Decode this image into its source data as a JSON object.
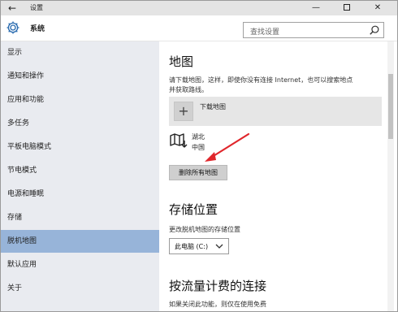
{
  "window": {
    "title": "设置"
  },
  "header": {
    "section_title": "系统",
    "search_placeholder": "查找设置"
  },
  "sidebar": {
    "items": [
      {
        "label": "显示",
        "active": false
      },
      {
        "label": "通知和操作",
        "active": false
      },
      {
        "label": "应用和功能",
        "active": false
      },
      {
        "label": "多任务",
        "active": false
      },
      {
        "label": "平板电脑模式",
        "active": false
      },
      {
        "label": "节电模式",
        "active": false
      },
      {
        "label": "电源和睡眠",
        "active": false
      },
      {
        "label": "存储",
        "active": false
      },
      {
        "label": "脱机地图",
        "active": true
      },
      {
        "label": "默认应用",
        "active": false
      },
      {
        "label": "关于",
        "active": false
      }
    ]
  },
  "main": {
    "maps_heading": "地图",
    "maps_desc_line1": "请下载地图，这样，即使你没有连接 Internet，也可以搜索地点",
    "maps_desc_line2": "并获取路线。",
    "download_label": "下载地图",
    "map_item": {
      "name": "湖北",
      "region": "中国"
    },
    "delete_all_label": "删除所有地图",
    "storage_heading": "存储位置",
    "storage_desc": "更改脱机地图的存储位置",
    "storage_value": "此电脑 (C:)",
    "metered_heading": "按流量计费的连接",
    "metered_desc": "如果关闭此功能，则仅在使用免费"
  },
  "colors": {
    "sidebar_bg": "#e9ebf0",
    "active_item": "#97b4d9",
    "annotation_arrow": "#e0262b"
  },
  "icons": {
    "back": "back-arrow-icon",
    "gear": "gear-icon",
    "search": "search-icon",
    "plus": "plus-icon",
    "map": "map-download-icon",
    "chevron": "chevron-down-icon"
  }
}
